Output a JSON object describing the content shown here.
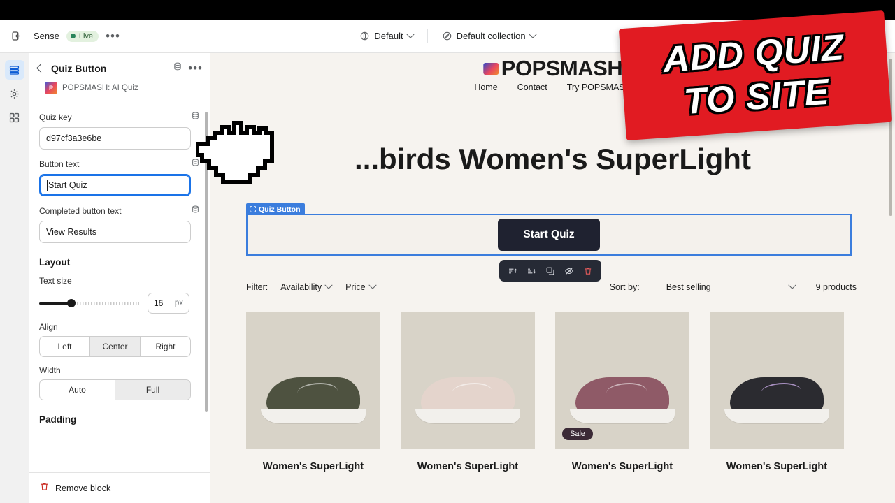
{
  "topbar": {
    "exit_icon": "exit-icon",
    "store_name": "Sense",
    "status_label": "Live",
    "more_label": "•••",
    "theme_selector": "Default",
    "collection_selector": "Default collection",
    "devices": [
      "desktop-view-icon",
      "tablet-view-icon",
      "mobile-view-icon"
    ]
  },
  "rail": {
    "items": [
      {
        "name": "sections-icon",
        "active": true
      },
      {
        "name": "settings-gear-icon",
        "active": false
      },
      {
        "name": "apps-icon",
        "active": false
      }
    ]
  },
  "sidebar": {
    "title": "Quiz Button",
    "app_initials": "P",
    "app_name": "POPSMASH: AI Quiz",
    "fields": [
      {
        "label": "Quiz key",
        "value": "d97cf3a3e6be",
        "focused": false
      },
      {
        "label": "Button text",
        "value": "Start Quiz",
        "focused": true
      },
      {
        "label": "Completed button text",
        "value": "View Results",
        "focused": false
      }
    ],
    "layout_heading": "Layout",
    "text_size": {
      "label": "Text size",
      "value": "16",
      "unit": "px"
    },
    "align": {
      "label": "Align",
      "options": [
        "Left",
        "Center",
        "Right"
      ],
      "selected": "Center"
    },
    "width": {
      "label": "Width",
      "options": [
        "Auto",
        "Full"
      ],
      "selected": "Full"
    },
    "padding_heading": "Padding",
    "remove_label": "Remove block"
  },
  "preview": {
    "logo_text": "POPSMASH",
    "nav": [
      "Home",
      "Contact",
      "Try POPSMASH"
    ],
    "hero_title": "...birds Women's SuperLight",
    "block_tag": "Quiz Button",
    "quiz_button_label": "Start Quiz",
    "toolbar_icons": [
      "move-up-icon",
      "move-down-icon",
      "duplicate-icon",
      "hide-icon",
      "delete-icon"
    ],
    "filter_label": "Filter:",
    "filters": [
      "Availability",
      "Price"
    ],
    "sort_label": "Sort by:",
    "sort_value": "Best selling",
    "product_count": "9 products",
    "products": [
      {
        "title": "Women's SuperLight",
        "color": "#4e5240",
        "badge": ""
      },
      {
        "title": "Women's SuperLight",
        "color": "#e4d4cc",
        "badge": ""
      },
      {
        "title": "Women's SuperLight",
        "color": "#8f5a67",
        "badge": "Sale"
      },
      {
        "title": "Women's SuperLight",
        "color": "#2b2b30",
        "badge": ""
      }
    ]
  },
  "sticker": {
    "line1": "ADD QUIZ",
    "line2": "TO SITE",
    "color": "#e11b22"
  }
}
